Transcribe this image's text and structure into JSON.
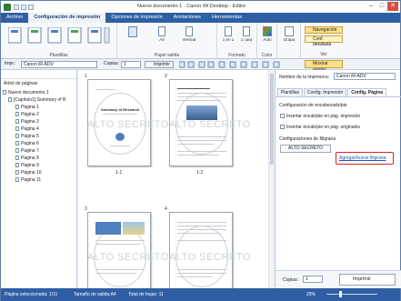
{
  "window": {
    "title": "Nuevo documento 1 - Canon iW Desktop - Editor"
  },
  "ribbon_tabs": [
    "Archivo",
    "Configuración de impresión",
    "Opciones de impresión",
    "Anotaciones",
    "Herramientas"
  ],
  "ribbon": {
    "groups": [
      "Plantillas",
      "Papel salida",
      "Formato",
      "Color",
      "Grapa",
      "Ver"
    ],
    "paper_size": "A4",
    "orientation": "Vertical",
    "copies_per_sheet": "1 en 1",
    "sides": "1 cara",
    "color_mode": "Auto",
    "staple": "Grapa",
    "nav_button": "Navegación",
    "detail_button": "Conf. detallada"
  },
  "toolbar": {
    "printer_label": "Impr.:",
    "printer_value": "Canon iR-ADV",
    "copies_label": "Copias:",
    "copies_value": "1",
    "print_button": "Imprimir",
    "show_annotations": "Mostrar anotac."
  },
  "left_panel": {
    "title": "Árbol de páginas",
    "tree": [
      "Nuevo documento 1",
      "[Capítulo1] Summary of R",
      "Página 1",
      "Página 2",
      "Página 3",
      "Página 4",
      "Página 5",
      "Página 6",
      "Página 7",
      "Página 8",
      "Página 9",
      "Página 10",
      "Página 11"
    ]
  },
  "center": {
    "watermark_text": "ALTO SECRETO",
    "pages": [
      {
        "number": "1",
        "label": "1-1",
        "heading": "Summary of Research"
      },
      {
        "number": "2",
        "label": "1-2",
        "heading": "Introduction"
      },
      {
        "number": "3",
        "label": "",
        "heading": ""
      },
      {
        "number": "4",
        "label": "",
        "heading": ""
      }
    ]
  },
  "right_panel": {
    "printer_name_label": "Nombre de la impresora:",
    "printer_name_value": "Canon iR-ADV",
    "tabs": [
      "Plantillas",
      "Config. Impresión",
      "Config. Página"
    ],
    "active_tab": "Config. Página",
    "section_header_footer": "Configuración de encabezado/pie",
    "option_insert_print": "Insertar encab/pie en pág. impresión",
    "option_insert_original": "Insertar encab/pie en pág. originales",
    "section_watermark": "Configuraciones de filigrana",
    "watermark_item": "ALTO SECRETO",
    "add_watermark_link": "Agregar/borrar filigrana",
    "copies_label": "Copias:",
    "copies_value": "1",
    "print_button": "Imprimir"
  },
  "status": {
    "selected_page": "Página seleccionada: 1/11",
    "output_size": "Tamaño de salida:A4",
    "total_sheets": "Total de hojas: 11",
    "zoom": "25%"
  },
  "colors": {
    "accent": "#2e5fa3",
    "highlight": "#ffe08a",
    "callout": "#e02020"
  }
}
